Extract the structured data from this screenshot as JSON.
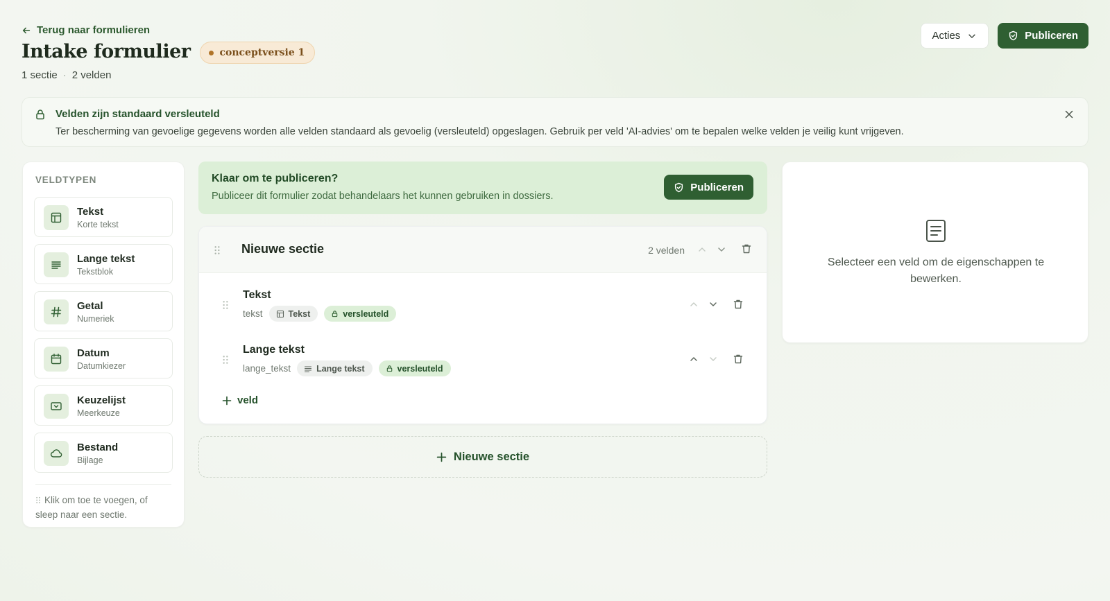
{
  "header": {
    "back_label": "Terug naar formulieren",
    "title": "Intake formulier",
    "draft_badge": "conceptversie 1",
    "section_count": "1 sectie",
    "separator": "·",
    "field_count": "2 velden",
    "actions_label": "Acties",
    "publish_label": "Publiceren"
  },
  "notice": {
    "title": "Velden zijn standaard versleuteld",
    "text": "Ter bescherming van gevoelige gegevens worden alle velden standaard als gevoelig (versleuteld) opgeslagen. Gebruik per veld 'AI-advies' om te bepalen welke velden je veilig kunt vrijgeven."
  },
  "field_types": {
    "heading": "VELDTYPEN",
    "items": [
      {
        "label": "Tekst",
        "sub": "Korte tekst",
        "icon": "layout-icon"
      },
      {
        "label": "Lange tekst",
        "sub": "Tekstblok",
        "icon": "text-lines-icon"
      },
      {
        "label": "Getal",
        "sub": "Numeriek",
        "icon": "hash-icon"
      },
      {
        "label": "Datum",
        "sub": "Datumkiezer",
        "icon": "calendar-icon"
      },
      {
        "label": "Keuzelijst",
        "sub": "Meerkeuze",
        "icon": "select-icon"
      },
      {
        "label": "Bestand",
        "sub": "Bijlage",
        "icon": "cloud-icon"
      }
    ],
    "hint": "Klik om toe te voegen, of sleep naar een sectie."
  },
  "ready": {
    "title": "Klaar om te publiceren?",
    "text": "Publiceer dit formulier zodat behandelaars het kunnen gebruiken in dossiers.",
    "button": "Publiceren"
  },
  "section": {
    "name": "Nieuwe sectie",
    "count": "2 velden",
    "fields": [
      {
        "name": "Tekst",
        "key": "tekst",
        "type": "Tekst",
        "encrypted": "versleuteld"
      },
      {
        "name": "Lange tekst",
        "key": "lange_tekst",
        "type": "Lange tekst",
        "encrypted": "versleuteld"
      }
    ],
    "add_field": "veld"
  },
  "new_section_label": "Nieuwe sectie",
  "properties": {
    "empty_text": "Selecteer een veld om de eigenschappen te bewerken."
  },
  "colors": {
    "brand_green": "#2f5f32",
    "light_green": "#dcefd7",
    "draft_bg": "#f8ead6"
  }
}
